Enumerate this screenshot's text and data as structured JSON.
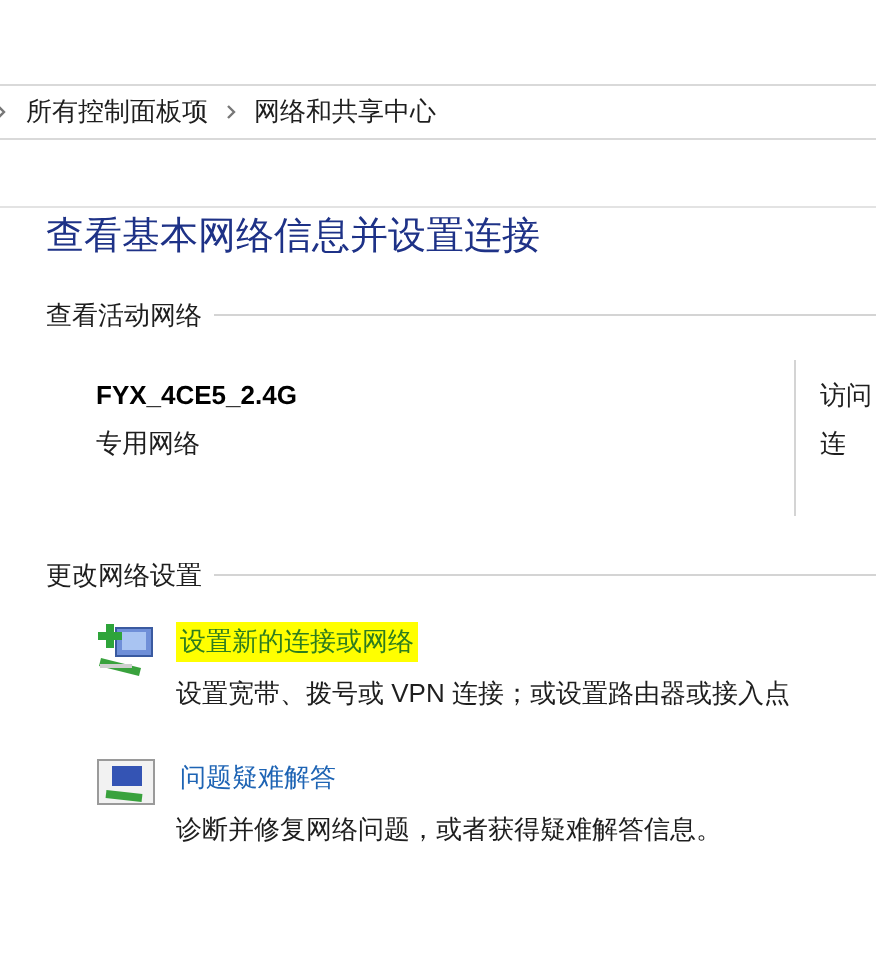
{
  "breadcrumb": [
    {
      "label": "所有控制面板项"
    },
    {
      "label": "网络和共享中心"
    }
  ],
  "title": "查看基本网络信息并设置连接",
  "active_networks": {
    "heading": "查看活动网络",
    "name": "FYX_4CE5_2.4G",
    "category": "专用网络",
    "right_lines": [
      "访问",
      "连"
    ]
  },
  "change_settings": {
    "heading": "更改网络设置",
    "items": [
      {
        "kind": "new-connection",
        "link": "设置新的连接或网络",
        "description": "设置宽带、拨号或 VPN 连接；或设置路由器或接入点",
        "highlighted": true
      },
      {
        "kind": "troubleshoot",
        "link": "问题疑难解答",
        "description": "诊断并修复网络问题，或者获得疑难解答信息。",
        "highlighted": false
      }
    ]
  }
}
